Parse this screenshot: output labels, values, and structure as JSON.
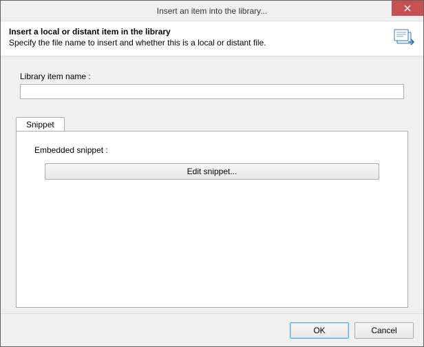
{
  "window": {
    "title": "Insert an item into the library..."
  },
  "header": {
    "title": "Insert a local or distant item in the library",
    "subtitle": "Specify the file name to insert and whether this is a local or distant file."
  },
  "form": {
    "library_item_name_label": "Library item name :",
    "library_item_name_value": ""
  },
  "tabs": {
    "snippet_label": "Snippet"
  },
  "snippet_panel": {
    "embedded_label": "Embedded snippet :",
    "edit_button": "Edit snippet..."
  },
  "buttons": {
    "ok": "OK",
    "cancel": "Cancel"
  }
}
